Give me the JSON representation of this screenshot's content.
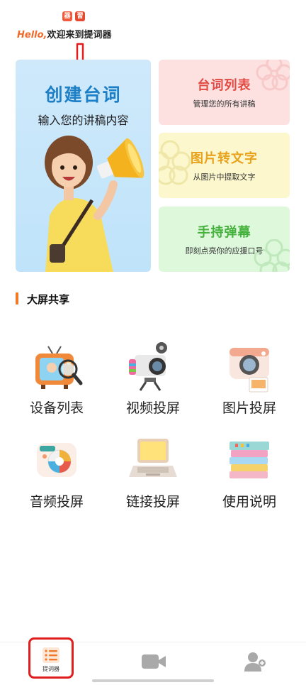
{
  "header": {
    "badge_left": "器",
    "badge_right": "習",
    "hello_word": "Hello,",
    "welcome_text": "欢迎来到提词器"
  },
  "cards": {
    "create": {
      "title": "创建台词",
      "subtitle": "输入您的讲稿内容"
    },
    "script_list": {
      "title": "台词列表",
      "subtitle": "管理您的所有讲稿"
    },
    "image_to_text": {
      "title": "图片转文字",
      "subtitle": "从图片中提取文字"
    },
    "handheld": {
      "title": "手持弹幕",
      "subtitle": "即刻点亮你的应援口号"
    }
  },
  "section": {
    "title": "大屏共享"
  },
  "grid": [
    {
      "label": "设备列表",
      "icon": "tv-icon"
    },
    {
      "label": "视频投屏",
      "icon": "video-camera-icon"
    },
    {
      "label": "图片投屏",
      "icon": "instant-camera-icon"
    },
    {
      "label": "音频投屏",
      "icon": "audio-player-icon"
    },
    {
      "label": "链接投屏",
      "icon": "laptop-icon"
    },
    {
      "label": "使用说明",
      "icon": "books-icon"
    }
  ],
  "tabs": [
    {
      "label": "提词器",
      "icon": "list-icon",
      "active": true
    },
    {
      "label": "",
      "icon": "video-icon",
      "active": false
    },
    {
      "label": "",
      "icon": "user-icon",
      "active": false
    }
  ],
  "colors": {
    "accent": "#f07a2a",
    "create_title": "#1d7fc6",
    "script_title": "#e14a43",
    "image_title": "#e8a21b",
    "hand_title": "#44b23c",
    "highlight_red": "#e01e1e"
  }
}
